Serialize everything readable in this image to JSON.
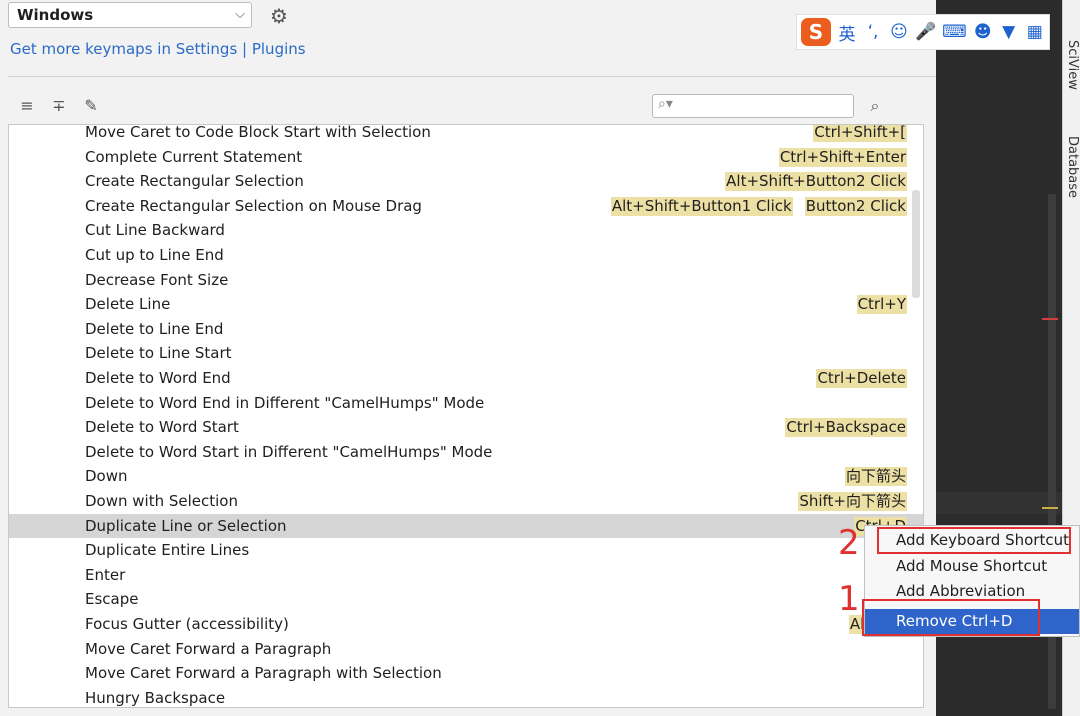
{
  "keymap": {
    "selected": "Windows"
  },
  "settings_link": "Get more keymaps in Settings | Plugins",
  "search": {
    "placeholder": ""
  },
  "actions": [
    {
      "name": "Move Caret to Code Block Start with Selection",
      "shortcuts": [
        "Ctrl+Shift+["
      ]
    },
    {
      "name": "Complete Current Statement",
      "shortcuts": [
        "Ctrl+Shift+Enter"
      ]
    },
    {
      "name": "Create Rectangular Selection",
      "shortcuts": [
        "Alt+Shift+Button2 Click"
      ]
    },
    {
      "name": "Create Rectangular Selection on Mouse Drag",
      "shortcuts": [
        "Alt+Shift+Button1 Click",
        "Button2 Click"
      ]
    },
    {
      "name": "Cut Line Backward",
      "shortcuts": []
    },
    {
      "name": "Cut up to Line End",
      "shortcuts": []
    },
    {
      "name": "Decrease Font Size",
      "shortcuts": []
    },
    {
      "name": "Delete Line",
      "shortcuts": [
        "Ctrl+Y"
      ]
    },
    {
      "name": "Delete to Line End",
      "shortcuts": []
    },
    {
      "name": "Delete to Line Start",
      "shortcuts": []
    },
    {
      "name": "Delete to Word End",
      "shortcuts": [
        "Ctrl+Delete"
      ]
    },
    {
      "name": "Delete to Word End in Different \"CamelHumps\" Mode",
      "shortcuts": []
    },
    {
      "name": "Delete to Word Start",
      "shortcuts": [
        "Ctrl+Backspace"
      ]
    },
    {
      "name": "Delete to Word Start in Different \"CamelHumps\" Mode",
      "shortcuts": []
    },
    {
      "name": "Down",
      "shortcuts": [
        "向下箭头"
      ]
    },
    {
      "name": "Down with Selection",
      "shortcuts": [
        "Shift+向下箭头"
      ]
    },
    {
      "name": "Duplicate Line or Selection",
      "shortcuts": [
        "Ctrl+D"
      ],
      "selected": true
    },
    {
      "name": "Duplicate Entire Lines",
      "shortcuts": []
    },
    {
      "name": "Enter",
      "shortcuts": []
    },
    {
      "name": "Escape",
      "shortcuts": []
    },
    {
      "name": "Focus Gutter (accessibility)",
      "shortcuts": [
        "Alt+Shi"
      ]
    },
    {
      "name": "Move Caret Forward a Paragraph",
      "shortcuts": []
    },
    {
      "name": "Move Caret Forward a Paragraph with Selection",
      "shortcuts": []
    },
    {
      "name": "Hungry Backspace",
      "shortcuts": []
    }
  ],
  "context_menu": {
    "items": [
      {
        "label": "Add Keyboard Shortcut"
      },
      {
        "label": "Add Mouse Shortcut"
      },
      {
        "label": "Add Abbreviation"
      },
      {
        "label": "Remove Ctrl+D",
        "active": true
      }
    ]
  },
  "annotations": {
    "step1": "1",
    "step2": "2"
  },
  "ime_toolbar": {
    "brand": "S",
    "lang": "英",
    "items": [
      "punctuation-icon",
      "emoji-icon",
      "microphone-icon",
      "keyboard-icon",
      "user-icon",
      "tshirt-icon",
      "grid-icon"
    ]
  },
  "side_tabs": {
    "sciview": "SciView",
    "database": "Database"
  },
  "colors": {
    "shortcut_bg": "#ede0a5",
    "menu_active": "#2f65ca",
    "annotation_red": "#e03030"
  }
}
